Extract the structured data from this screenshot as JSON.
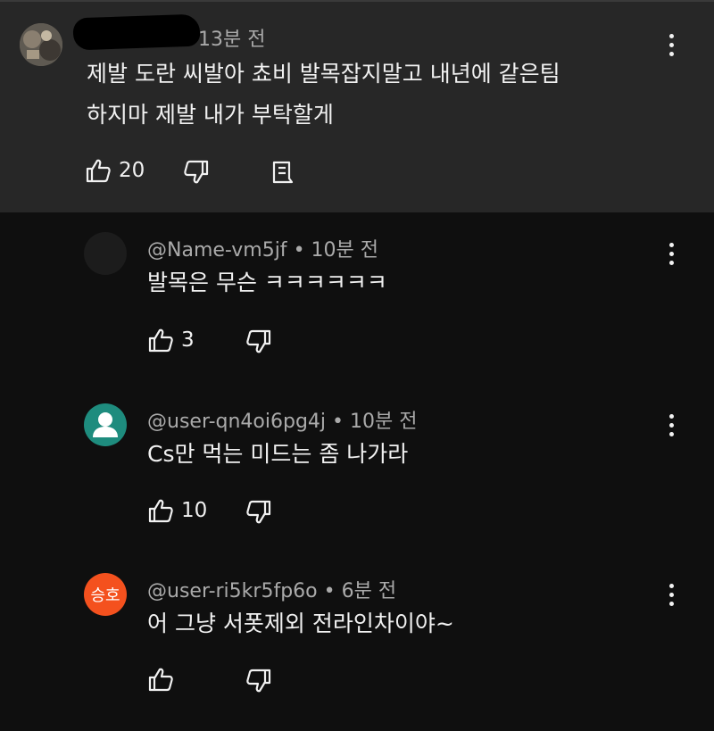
{
  "parent_comment": {
    "time": "13분 전",
    "text_line1": "제발 도란 씨발아 쵸비 발목잡지말고 내년에 같은팀",
    "text_line2": "하지마 제발 내가 부탁할게",
    "likes": "20"
  },
  "replies": [
    {
      "handle": "@Name-vm5jf",
      "time": "10분 전",
      "text": "발목은 무슨 ㅋㅋㅋㅋㅋㅋ",
      "likes": "3"
    },
    {
      "handle": "@user-qn4oi6pg4j",
      "time": "10분 전",
      "text": "Cs만 먹는 미드는 좀 나가라",
      "likes": "10"
    },
    {
      "handle": "@user-ri5kr5fp6o",
      "time": "6분 전",
      "text": "어 그냥 서폿제외 전라인차이야~",
      "likes": "",
      "avatar_text": "승호"
    }
  ],
  "separator": "•",
  "colors": {
    "parent_bg": "#272727",
    "page_bg": "#0f0f0f",
    "avatar_teal": "#1e8c7e",
    "avatar_orange": "#f4511e"
  }
}
